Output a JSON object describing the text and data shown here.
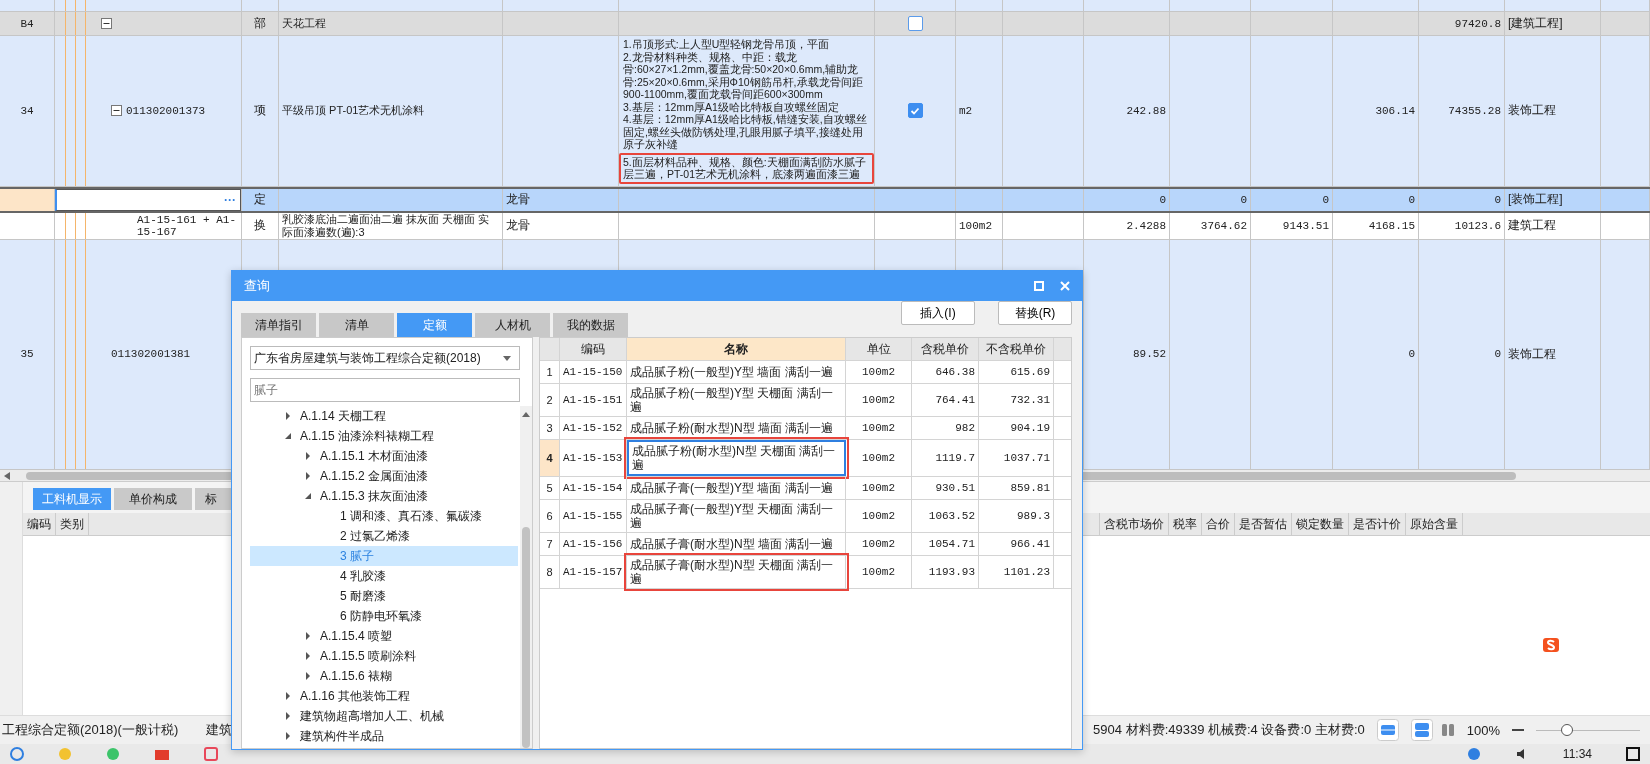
{
  "main_table": {
    "rows": [
      {
        "kind": "partial"
      },
      {
        "kind": "section",
        "number": "B4",
        "expanded": true,
        "type": "部",
        "name": "天花工程",
        "checked": false,
        "total": "97420.8",
        "category": "[建筑工程]"
      },
      {
        "kind": "item",
        "number": "34",
        "expanded": true,
        "code": "011302001373",
        "type": "项",
        "name": "平级吊顶 PT-01艺术无机涂料",
        "features": [
          {
            "text": "1.吊顶形式:上人型U型轻钢龙骨吊顶，平面",
            "highlighted": false
          },
          {
            "text": "2.龙骨材料种类、规格、中距：载龙骨:60×27×1.2mm,覆盖龙骨:50×20×0.6mm,辅助龙骨:25×20×0.6mm,采用Φ10钢筋吊杆,承载龙骨间距900-1100mm,覆面龙载骨间距600×300mm",
            "highlighted": false
          },
          {
            "text": "3.基层：12mm厚A1级哈比特板自攻螺丝固定",
            "highlighted": false
          },
          {
            "text": "4.基层：12mm厚A1级哈比特板,错缝安装,自攻螺丝固定,螺丝头做防锈处理,孔眼用腻子填平,接缝处用原子灰补缝",
            "highlighted": false
          },
          {
            "text": "5.面层材料品种、规格、颜色:天棚面满刮防水腻子层三遍，PT-01艺术无机涂料，底漆两遍面漆三遍",
            "highlighted": true
          }
        ],
        "checked": true,
        "unit": "m2",
        "quantity": "242.88",
        "column_13": "306.14",
        "total": "74355.28",
        "category": "装饰工程"
      },
      {
        "kind": "quota",
        "editing_button": "···",
        "type": "定",
        "column_5": "龙骨",
        "quantity": "0",
        "unit_price": "0",
        "column_12": "0",
        "column_13": "0",
        "total": "0",
        "category": "[装饰工程]"
      },
      {
        "kind": "sub",
        "code": "A1-15-161 + A1-15-167",
        "type": "换",
        "name": "乳胶漆底油二遍面油二遍 抹灰面 天棚面 实际面漆遍数(遍):3",
        "column_5": "龙骨",
        "unit": "100m2",
        "quantity": "2.4288",
        "unit_price": "3764.62",
        "column_12": "9143.51",
        "column_13": "4168.15",
        "total": "10123.6",
        "category": "建筑工程"
      },
      {
        "kind": "item",
        "number": "35",
        "code": "011302001381",
        "quantity": "89.52",
        "column_13": "0",
        "total": "0",
        "category": "装饰工程"
      }
    ]
  },
  "dialog": {
    "title": "查询",
    "tabs": [
      {
        "label": "清单指引",
        "selected": false
      },
      {
        "label": "清单",
        "selected": false
      },
      {
        "label": "定额",
        "selected": true
      },
      {
        "label": "人材机",
        "selected": false
      },
      {
        "label": "我的数据",
        "selected": false
      }
    ],
    "buttons": [
      "插入(I)",
      "替换(R)"
    ],
    "library_select": {
      "value": "广东省房屋建筑与装饰工程综合定额(2018)"
    },
    "search": {
      "placeholder": "腻子"
    },
    "tree": [
      {
        "label": "A.1.14 天棚工程",
        "expanded": false,
        "selected": false
      },
      {
        "label": "A.1.15 油漆涂料裱糊工程",
        "expanded": true,
        "selected": false,
        "children": [
          {
            "label": "A.1.15.1 木材面油漆",
            "expanded": false,
            "selected": false
          },
          {
            "label": "A.1.15.2 金属面油漆",
            "expanded": false,
            "selected": false
          },
          {
            "label": "A.1.15.3 抹灰面油漆",
            "expanded": true,
            "selected": false,
            "children": [
              {
                "label": "1 调和漆、真石漆、氟碳漆",
                "selected": false
              },
              {
                "label": "2 过氯乙烯漆",
                "selected": false
              },
              {
                "label": "3 腻子",
                "selected": true
              },
              {
                "label": "4 乳胶漆",
                "selected": false
              },
              {
                "label": "5 耐磨漆",
                "selected": false
              },
              {
                "label": "6 防静电环氧漆",
                "selected": false
              }
            ]
          },
          {
            "label": "A.1.15.4 喷塑",
            "expanded": false,
            "selected": false
          },
          {
            "label": "A.1.15.5 喷刷涂料",
            "expanded": false,
            "selected": false
          },
          {
            "label": "A.1.15.6 裱糊",
            "expanded": false,
            "selected": false
          }
        ]
      },
      {
        "label": "A.1.16 其他装饰工程",
        "expanded": false,
        "selected": false
      },
      {
        "label": "建筑物超高增加人工、机械",
        "expanded": false,
        "selected": false
      },
      {
        "label": "建筑构件半成品",
        "expanded": false,
        "selected": false
      }
    ],
    "table": {
      "columns": [
        {
          "label": "编码",
          "active": false
        },
        {
          "label": "名称",
          "active": true
        },
        {
          "label": "单位",
          "active": false
        },
        {
          "label": "含税单价",
          "active": false
        },
        {
          "label": "不含税单价",
          "active": false
        }
      ],
      "rows": [
        {
          "number": "1",
          "code": "A1-15-150",
          "name": "成品腻子粉(一般型)Y型 墙面 满刮一遍",
          "unit": "100m2",
          "tax_price": "646.38",
          "net_price": "615.69",
          "selected": false,
          "highlighted": false
        },
        {
          "number": "2",
          "code": "A1-15-151",
          "name": "成品腻子粉(一般型)Y型 天棚面 满刮一遍",
          "unit": "100m2",
          "tax_price": "764.41",
          "net_price": "732.31",
          "selected": false,
          "highlighted": false
        },
        {
          "number": "3",
          "code": "A1-15-152",
          "name": "成品腻子粉(耐水型)N型 墙面 满刮一遍",
          "unit": "100m2",
          "tax_price": "982",
          "net_price": "904.19",
          "selected": false,
          "highlighted": false
        },
        {
          "number": "4",
          "code": "A1-15-153",
          "name": "成品腻子粉(耐水型)N型 天棚面 满刮一遍",
          "unit": "100m2",
          "tax_price": "1119.7",
          "net_price": "1037.71",
          "selected": true,
          "highlighted": true
        },
        {
          "number": "5",
          "code": "A1-15-154",
          "name": "成品腻子膏(一般型)Y型 墙面 满刮一遍",
          "unit": "100m2",
          "tax_price": "930.51",
          "net_price": "859.81",
          "selected": false,
          "highlighted": false
        },
        {
          "number": "6",
          "code": "A1-15-155",
          "name": "成品腻子膏(一般型)Y型 天棚面 满刮一遍",
          "unit": "100m2",
          "tax_price": "1063.52",
          "net_price": "989.3",
          "selected": false,
          "highlighted": false
        },
        {
          "number": "7",
          "code": "A1-15-156",
          "name": "成品腻子膏(耐水型)N型 墙面 满刮一遍",
          "unit": "100m2",
          "tax_price": "1054.71",
          "net_price": "966.41",
          "selected": false,
          "highlighted": false
        },
        {
          "number": "8",
          "code": "A1-15-157",
          "name": "成品腻子膏(耐水型)N型 天棚面 满刮一遍",
          "unit": "100m2",
          "tax_price": "1193.93",
          "net_price": "1101.23",
          "selected": false,
          "highlighted": true
        }
      ]
    }
  },
  "bottom_panel": {
    "tabs": [
      {
        "label": "工料机显示",
        "selected": true
      },
      {
        "label": "单价构成",
        "selected": false
      },
      {
        "label": "标",
        "selected": false
      }
    ],
    "columns_left": [
      "编码",
      "类别"
    ],
    "columns_right": [
      "含税市场价",
      "税率",
      "合价",
      "是否暂估",
      "锁定数量",
      "是否计价",
      "原始含量"
    ]
  },
  "status_bar": {
    "left": [
      "工程综合定额(2018)(一般计税)",
      "建筑"
    ],
    "summary": "5904 材料费:49339 机械费:4 设备费:0 主材费:0",
    "zoom": "100%",
    "zoom_slider": {
      "level": 0.3
    }
  },
  "taskbar": {
    "time": "11:34"
  }
}
